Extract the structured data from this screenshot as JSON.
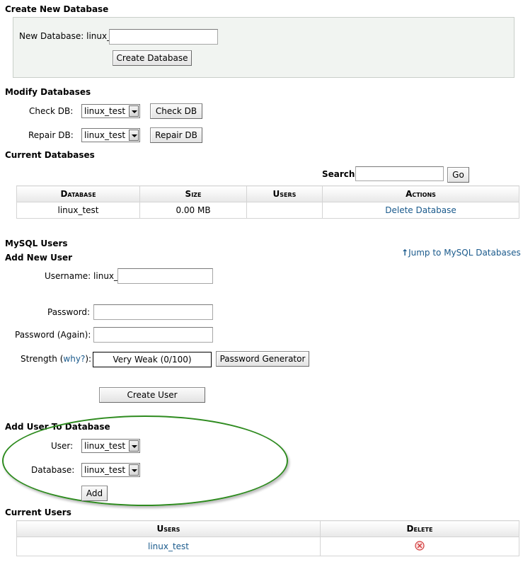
{
  "create_db": {
    "heading": "Create New Database",
    "label": "New Database:",
    "prefix": "linux_",
    "input_value": "",
    "button": "Create Database"
  },
  "modify": {
    "heading": "Modify Databases",
    "check_label": "Check DB:",
    "check_value": "linux_test",
    "check_button": "Check DB",
    "repair_label": "Repair DB:",
    "repair_value": "linux_test",
    "repair_button": "Repair DB"
  },
  "current_dbs": {
    "heading": "Current Databases",
    "search_label": "Search",
    "search_value": "",
    "go_button": "Go",
    "columns": [
      "Database",
      "Size",
      "Users",
      "Actions"
    ],
    "rows": [
      {
        "database": "linux_test",
        "size": "0.00 MB",
        "users": "",
        "action": "Delete Database"
      }
    ]
  },
  "users": {
    "heading": "MySQL Users",
    "jump_link": "Jump to MySQL Databases",
    "add_heading": "Add New User",
    "username_label": "Username:",
    "username_prefix": "linux_",
    "username_value": "",
    "password_label": "Password:",
    "password_again_label": "Password (Again):",
    "strength_label": "Strength",
    "why_link": "why?",
    "strength_value": "Very Weak (0/100)",
    "generator_button": "Password Generator",
    "create_button": "Create User"
  },
  "add_to_db": {
    "heading": "Add User To Database",
    "user_label": "User:",
    "user_value": "linux_test",
    "db_label": "Database:",
    "db_value": "linux_test",
    "add_button": "Add"
  },
  "current_users": {
    "heading": "Current Users",
    "columns": [
      "Users",
      "Delete"
    ],
    "rows": [
      {
        "user": "linux_test"
      }
    ],
    "highlight_color": "#2e8b1f"
  }
}
